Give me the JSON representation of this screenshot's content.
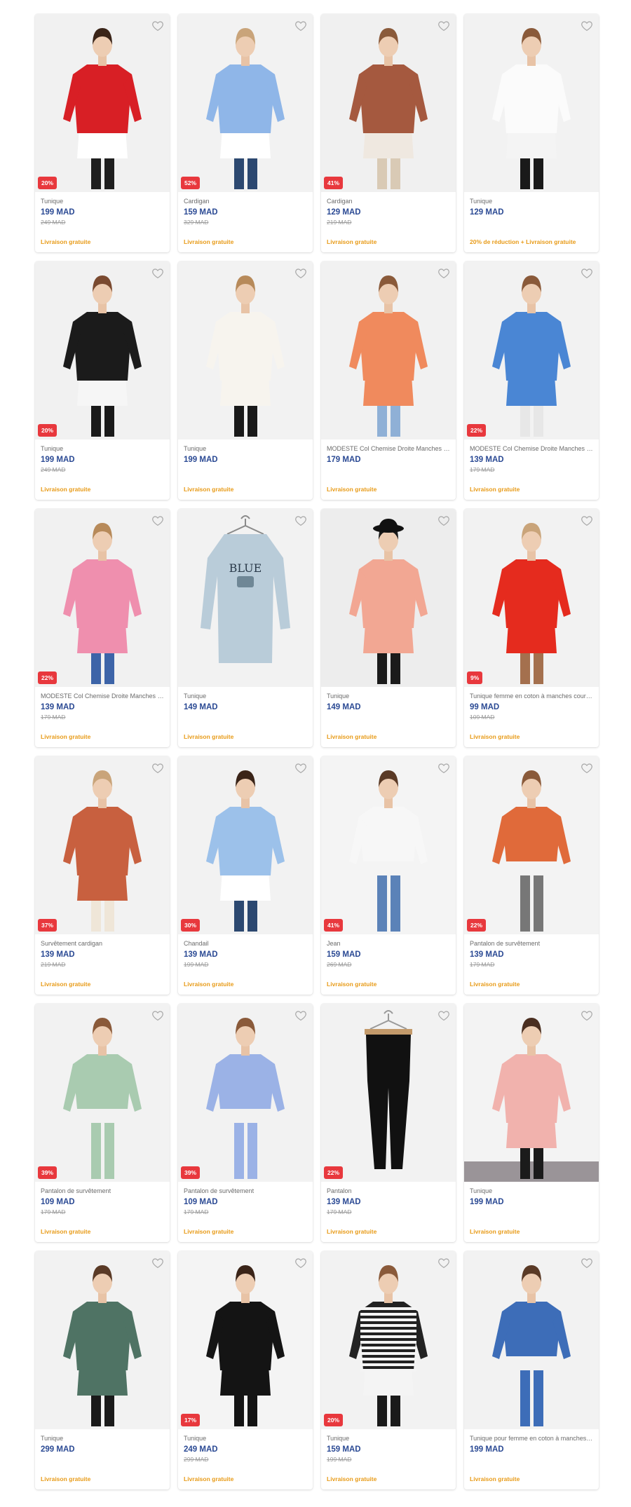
{
  "colors": {
    "price": "#2b4a94",
    "badge": "#e8383d",
    "shipping": "#e89b18"
  },
  "products": [
    {
      "title": "Tunique",
      "price": "199 MAD",
      "old_price": "249 MAD",
      "badge": "20%",
      "shipping": "Livraison gratuite",
      "img": {
        "bg": "#f1f1f1",
        "top": "#d81f25",
        "bottom": "#ffffff",
        "legs": "#1f1f1f",
        "hair": "#3a2418",
        "hat": false,
        "hanger": false,
        "long": true
      }
    },
    {
      "title": "Cardigan",
      "price": "159 MAD",
      "old_price": "329 MAD",
      "badge": "52%",
      "shipping": "Livraison gratuite",
      "img": {
        "bg": "#f2f2f2",
        "top": "#8fb6e8",
        "bottom": "#ffffff",
        "legs": "#2c4870",
        "hair": "#c9a47a",
        "hat": false,
        "hanger": false,
        "long": true
      }
    },
    {
      "title": "Cardigan",
      "price": "129 MAD",
      "old_price": "219 MAD",
      "badge": "41%",
      "shipping": "Livraison gratuite",
      "img": {
        "bg": "#f0f0f0",
        "top": "#a5593f",
        "bottom": "#efe8e0",
        "legs": "#d9cab5",
        "hair": "#8a5a3a",
        "hat": false,
        "hanger": false,
        "long": true
      }
    },
    {
      "title": "Tunique",
      "price": "129 MAD",
      "old_price": "",
      "badge": "",
      "shipping": "20% de réduction + Livraison gratuite",
      "img": {
        "bg": "#f2f2f2",
        "top": "#fbfbfb",
        "bottom": "#f4f4f4",
        "legs": "#1a1a1a",
        "hair": "#8a5a3a",
        "hat": false,
        "hanger": false,
        "long": true
      }
    },
    {
      "title": "Tunique",
      "price": "199 MAD",
      "old_price": "249 MAD",
      "badge": "20%",
      "shipping": "Livraison gratuite",
      "img": {
        "bg": "#f1f1f1",
        "top": "#1b1b1b",
        "bottom": "#f6f6f6",
        "legs": "#1a1a1a",
        "hair": "#7a4a30",
        "hat": false,
        "hanger": false,
        "long": true
      }
    },
    {
      "title": "Tunique",
      "price": "199 MAD",
      "old_price": "",
      "badge": "",
      "shipping": "Livraison gratuite",
      "img": {
        "bg": "#f2f2f2",
        "top": "#f7f4ee",
        "bottom": "#f7f4ee",
        "legs": "#1a1a1a",
        "hair": "#b78a5a",
        "hat": false,
        "hanger": false,
        "long": true
      }
    },
    {
      "title": "MODESTE Col Chemise Droite Manches Longues Femme Tunique",
      "price": "179 MAD",
      "old_price": "",
      "badge": "",
      "shipping": "Livraison gratuite",
      "img": {
        "bg": "#f1f1f1",
        "top": "#f08a5d",
        "bottom": "#f08a5d",
        "legs": "#8fb0d6",
        "hair": "#8a5a3a",
        "hat": false,
        "hanger": false,
        "long": true
      }
    },
    {
      "title": "MODESTE Col Chemise Droite Manches Longues Femme Tunique",
      "price": "139 MAD",
      "old_price": "179 MAD",
      "badge": "22%",
      "shipping": "Livraison gratuite",
      "img": {
        "bg": "#f2f2f2",
        "top": "#4a86d4",
        "bottom": "#4a86d4",
        "legs": "#e7e7e7",
        "hair": "#8a5a3a",
        "hat": false,
        "hanger": false,
        "long": true
      }
    },
    {
      "title": "MODESTE Col Chemise Droite Manches Longues Femme Tunique",
      "price": "139 MAD",
      "old_price": "179 MAD",
      "badge": "22%",
      "shipping": "Livraison gratuite",
      "img": {
        "bg": "#f1f1f1",
        "top": "#ef8fae",
        "bottom": "#ef8fae",
        "legs": "#3d64a8",
        "hair": "#b78a5a",
        "hat": false,
        "hanger": false,
        "long": true
      }
    },
    {
      "title": "Tunique",
      "price": "149 MAD",
      "old_price": "",
      "badge": "",
      "shipping": "Livraison gratuite",
      "img": {
        "bg": "#f2f2f2",
        "top": "#b9ccd9",
        "bottom": "#b9ccd9",
        "legs": "#b9ccd9",
        "hair": "#b9ccd9",
        "hat": false,
        "hanger": true,
        "long": true,
        "print": "BLUE"
      }
    },
    {
      "title": "Tunique",
      "price": "149 MAD",
      "old_price": "",
      "badge": "",
      "shipping": "Livraison gratuite",
      "img": {
        "bg": "#ededed",
        "top": "#f2a793",
        "bottom": "#f2a793",
        "legs": "#1b1b1b",
        "hair": "#1a1a1a",
        "hat": true,
        "hanger": false,
        "long": true
      }
    },
    {
      "title": "Tunique femme en coton à manches courtes",
      "price": "99 MAD",
      "old_price": "109 MAD",
      "badge": "9%",
      "shipping": "Livraison gratuite",
      "img": {
        "bg": "#f2f2f2",
        "top": "#e52b1e",
        "bottom": "#e52b1e",
        "legs": "#a4704e",
        "hair": "#c9a47a",
        "hat": false,
        "hanger": false,
        "long": true
      }
    },
    {
      "title": "Survêtement cardigan",
      "price": "139 MAD",
      "old_price": "219 MAD",
      "badge": "37%",
      "shipping": "Livraison gratuite",
      "img": {
        "bg": "#f2f2f2",
        "top": "#c8603f",
        "bottom": "#c8603f",
        "legs": "#efe6d8",
        "hair": "#c9a47a",
        "hat": false,
        "hanger": false,
        "long": true
      }
    },
    {
      "title": "Chandail",
      "price": "139 MAD",
      "old_price": "199 MAD",
      "badge": "30%",
      "shipping": "Livraison gratuite",
      "img": {
        "bg": "#f2f2f2",
        "top": "#9cc1ea",
        "bottom": "#ffffff",
        "legs": "#2c4870",
        "hair": "#3a2418",
        "hat": false,
        "hanger": false,
        "long": true
      }
    },
    {
      "title": "Jean",
      "price": "159 MAD",
      "old_price": "269 MAD",
      "badge": "41%",
      "shipping": "Livraison gratuite",
      "img": {
        "bg": "#f4f4f4",
        "top": "#f7f7f7",
        "bottom": "#f7f7f7",
        "legs": "#5b82b8",
        "hair": "#5a3a26",
        "hat": false,
        "hanger": false,
        "long": false
      }
    },
    {
      "title": "Pantalon de survêtement",
      "price": "139 MAD",
      "old_price": "179 MAD",
      "badge": "22%",
      "shipping": "Livraison gratuite",
      "img": {
        "bg": "#f3f3f3",
        "top": "#e06a3a",
        "bottom": "#e06a3a",
        "legs": "#777777",
        "hair": "#8a5a3a",
        "hat": false,
        "hanger": false,
        "long": false
      }
    },
    {
      "title": "Pantalon de survêtement",
      "price": "109 MAD",
      "old_price": "179 MAD",
      "badge": "39%",
      "shipping": "Livraison gratuite",
      "img": {
        "bg": "#f2f2f2",
        "top": "#a9cbb0",
        "bottom": "#a9cbb0",
        "legs": "#a9cbb0",
        "hair": "#8a5a3a",
        "hat": false,
        "hanger": false,
        "long": false
      }
    },
    {
      "title": "Pantalon de survêtement",
      "price": "109 MAD",
      "old_price": "179 MAD",
      "badge": "39%",
      "shipping": "Livraison gratuite",
      "img": {
        "bg": "#f2f2f2",
        "top": "#9bb2e6",
        "bottom": "#9bb2e6",
        "legs": "#9bb2e6",
        "hair": "#8a5a3a",
        "hat": false,
        "hanger": false,
        "long": false
      }
    },
    {
      "title": "Pantalon",
      "price": "139 MAD",
      "old_price": "179 MAD",
      "badge": "22%",
      "shipping": "Livraison gratuite",
      "img": {
        "bg": "#f2f2f2",
        "top": "#111111",
        "bottom": "#111111",
        "legs": "#111111",
        "hair": "#111111",
        "hat": false,
        "hanger": true,
        "long": false,
        "pants": true
      }
    },
    {
      "title": "Tunique",
      "price": "199 MAD",
      "old_price": "",
      "badge": "",
      "shipping": "Livraison gratuite",
      "img": {
        "bg": "#f3f3f3",
        "top": "#f1b2ad",
        "bottom": "#f1b2ad",
        "legs": "#1b1b1b",
        "hair": "#4a2e20",
        "hat": false,
        "hanger": false,
        "long": true,
        "floor": "#9a9498"
      }
    },
    {
      "title": "Tunique",
      "price": "299 MAD",
      "old_price": "",
      "badge": "",
      "shipping": "Livraison gratuite",
      "img": {
        "bg": "#f2f2f2",
        "top": "#4f7364",
        "bottom": "#4f7364",
        "legs": "#1a1a1a",
        "hair": "#5a3a26",
        "hat": false,
        "hanger": false,
        "long": true
      }
    },
    {
      "title": "Tunique",
      "price": "249 MAD",
      "old_price": "299 MAD",
      "badge": "17%",
      "shipping": "Livraison gratuite",
      "img": {
        "bg": "#f4f4f4",
        "top": "#141414",
        "bottom": "#141414",
        "legs": "#141414",
        "hair": "#3a2418",
        "hat": false,
        "hanger": false,
        "long": true
      }
    },
    {
      "title": "Tunique",
      "price": "159 MAD",
      "old_price": "199 MAD",
      "badge": "20%",
      "shipping": "Livraison gratuite",
      "img": {
        "bg": "#f2f2f2",
        "top": "#222222",
        "bottom": "#f4f4f4",
        "legs": "#1a1a1a",
        "hair": "#8a5a3a",
        "hat": false,
        "hanger": false,
        "long": true,
        "stripes": true
      }
    },
    {
      "title": "Tunique pour femme en coton à manches longues",
      "price": "199 MAD",
      "old_price": "",
      "badge": "",
      "shipping": "Livraison gratuite",
      "img": {
        "bg": "#f2f2f2",
        "top": "#3d6db8",
        "bottom": "#3d6db8",
        "legs": "#3d6db8",
        "hair": "#5a3a26",
        "hat": false,
        "hanger": false,
        "long": false
      }
    }
  ]
}
